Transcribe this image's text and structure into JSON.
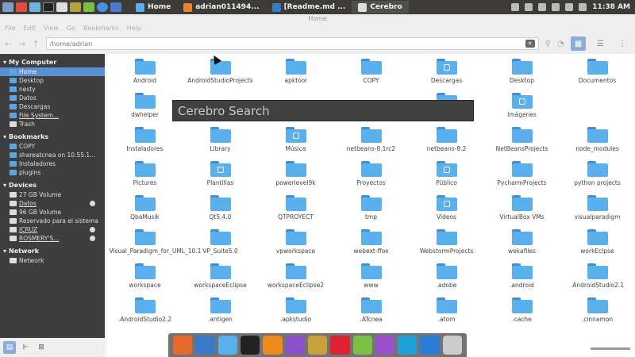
{
  "topbar": {
    "tasks": [
      {
        "label": "Home",
        "icon": "folder-icon",
        "active": false
      },
      {
        "label": "adrian011494...",
        "icon": "browser-icon",
        "active": false
      },
      {
        "label": "[Readme.md ...",
        "icon": "editor-icon",
        "active": false
      },
      {
        "label": "Cerebro",
        "icon": "cerebro-icon",
        "active": true
      }
    ],
    "clock": "11:38 AM"
  },
  "window": {
    "title": "Home",
    "menu": [
      "File",
      "Edit",
      "View",
      "Go",
      "Bookmarks",
      "Help"
    ],
    "path": "/home/adrian"
  },
  "sidebar": {
    "sections": [
      {
        "title": "My Computer",
        "items": [
          {
            "label": "Home",
            "selected": true
          },
          {
            "label": "Desktop"
          },
          {
            "label": "nesty"
          },
          {
            "label": "Datos"
          },
          {
            "label": "Descargas"
          },
          {
            "label": "File System...",
            "underline": true
          },
          {
            "label": "Trash",
            "white": true
          }
        ]
      },
      {
        "title": "Bookmarks",
        "items": [
          {
            "label": "COPY"
          },
          {
            "label": "shareatcnea on 10.55.1..."
          },
          {
            "label": "Instaladores"
          },
          {
            "label": "plugins"
          }
        ]
      },
      {
        "title": "Devices",
        "items": [
          {
            "label": "27 GB Volume",
            "white": true
          },
          {
            "label": "Datos",
            "white": true,
            "eject": true,
            "underline": true
          },
          {
            "label": "96 GB Volume",
            "white": true
          },
          {
            "label": "Reservado para el sistema",
            "white": true
          },
          {
            "label": "JCRUZ",
            "white": true,
            "eject": true,
            "underline": true
          },
          {
            "label": "ROSMERY'S...",
            "white": true,
            "eject": true,
            "underline": true
          }
        ]
      },
      {
        "title": "Network",
        "items": [
          {
            "label": "Network",
            "white": true
          }
        ]
      }
    ]
  },
  "files": [
    "Android",
    "AndroidStudioProjects",
    "apktool",
    "COPY",
    "Descargas",
    "Desktop",
    "Documentos",
    "dwhelper",
    "",
    "",
    "",
    "IdeaProjects",
    "Imágenes",
    "",
    "Instaladores",
    "Library",
    "Música",
    "netbeans-8.1rc2",
    "netbeans-8.2",
    "NetBeansProjects",
    "node_modules",
    "Pictures",
    "Plantillas",
    "powerlevel9k",
    "Proyectos",
    "Público",
    "PycharmProjects",
    "python projects",
    "QbaMusik",
    "Qt5.4.0",
    "QTPROYECT",
    "tmp",
    "Videos",
    "VirtualBox VMs",
    "visualparadigm",
    "Visual_Paradigm_for_UML_10.1",
    "VP_Suite5.0",
    "vpworkspace",
    "webext-ffox",
    "WebstormProjects",
    "wekafiles",
    "workEclpse",
    "workspace",
    "workspaceEclipse",
    "workspaceEclipse2",
    "www",
    ".adobe",
    ".android",
    ".AndroidStudio2.1",
    ".AndroidStudio2.2",
    ".antigen",
    ".apkstudio",
    ".ATcnea",
    ".atom",
    ".cache",
    ".cinnamon"
  ],
  "cerebro": {
    "placeholder": "Cerebro Search"
  },
  "dock": [
    "firefox",
    "globe",
    "files",
    "terminal",
    "vlc",
    "emote",
    "bag",
    "no-entry",
    "android",
    "phpstorm",
    "webstorm",
    "vscode",
    "cerebro"
  ]
}
